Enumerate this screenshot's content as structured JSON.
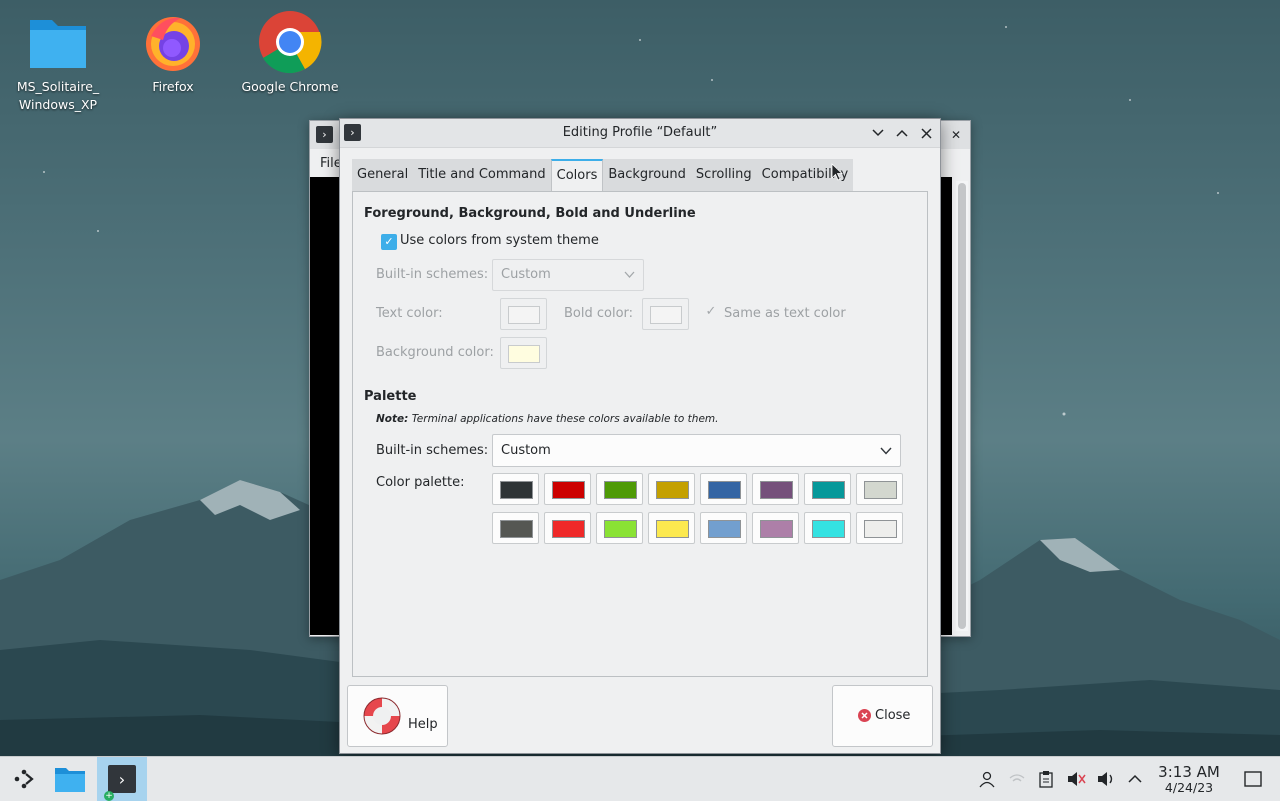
{
  "desktop": {
    "icons": [
      {
        "label_line1": "MS_Solitaire_",
        "label_line2": "Windows_XP",
        "icon": "folder-icon"
      },
      {
        "label": "Firefox",
        "icon": "firefox-icon"
      },
      {
        "label": "Google Chrome",
        "icon": "chrome-icon"
      }
    ]
  },
  "bg_window": {
    "menu_label": "File",
    "close_symbol": "✕"
  },
  "dialog": {
    "title": "Editing Profile “Default”",
    "controls": {
      "minimize": "﹀",
      "maximize": "︿",
      "close": "✕"
    },
    "tabs": [
      {
        "label": "General"
      },
      {
        "label": "Title and Command"
      },
      {
        "label": "Colors",
        "active": true
      },
      {
        "label": "Background"
      },
      {
        "label": "Scrolling"
      },
      {
        "label": "Compatibility"
      }
    ],
    "fg_section": {
      "title": "Foreground, Background, Bold and Underline",
      "use_system_theme_label": "Use colors from system theme",
      "use_system_theme_checked": true,
      "builtin_schemes_label": "Built-in schemes:",
      "builtin_schemes_value": "Custom",
      "text_color_label": "Text color:",
      "text_color": "#f4f4f4",
      "bold_color_label": "Bold color:",
      "bold_color": "#f4f4f4",
      "same_as_text_label": "Same as text color",
      "same_as_text_checked": true,
      "bg_color_label": "Background color:",
      "bg_color": "#fffde0"
    },
    "palette_section": {
      "title": "Palette",
      "note_bold": "Note:",
      "note_text": "Terminal applications have these colors available to them.",
      "builtin_schemes_label": "Built-in schemes:",
      "builtin_schemes_value": "Custom",
      "color_palette_label": "Color palette:",
      "row1": [
        "#2e3436",
        "#cc0000",
        "#4e9a06",
        "#c4a000",
        "#3465a4",
        "#75507b",
        "#06989a",
        "#d3d7cf"
      ],
      "row2": [
        "#555753",
        "#ef2929",
        "#8ae234",
        "#fce94f",
        "#729fcf",
        "#ad7fa8",
        "#34e2e2",
        "#eeeeec"
      ]
    },
    "help_label": "Help",
    "close_label": "Close"
  },
  "taskbar": {
    "time": "3:13 AM",
    "date": "4/24/23"
  }
}
